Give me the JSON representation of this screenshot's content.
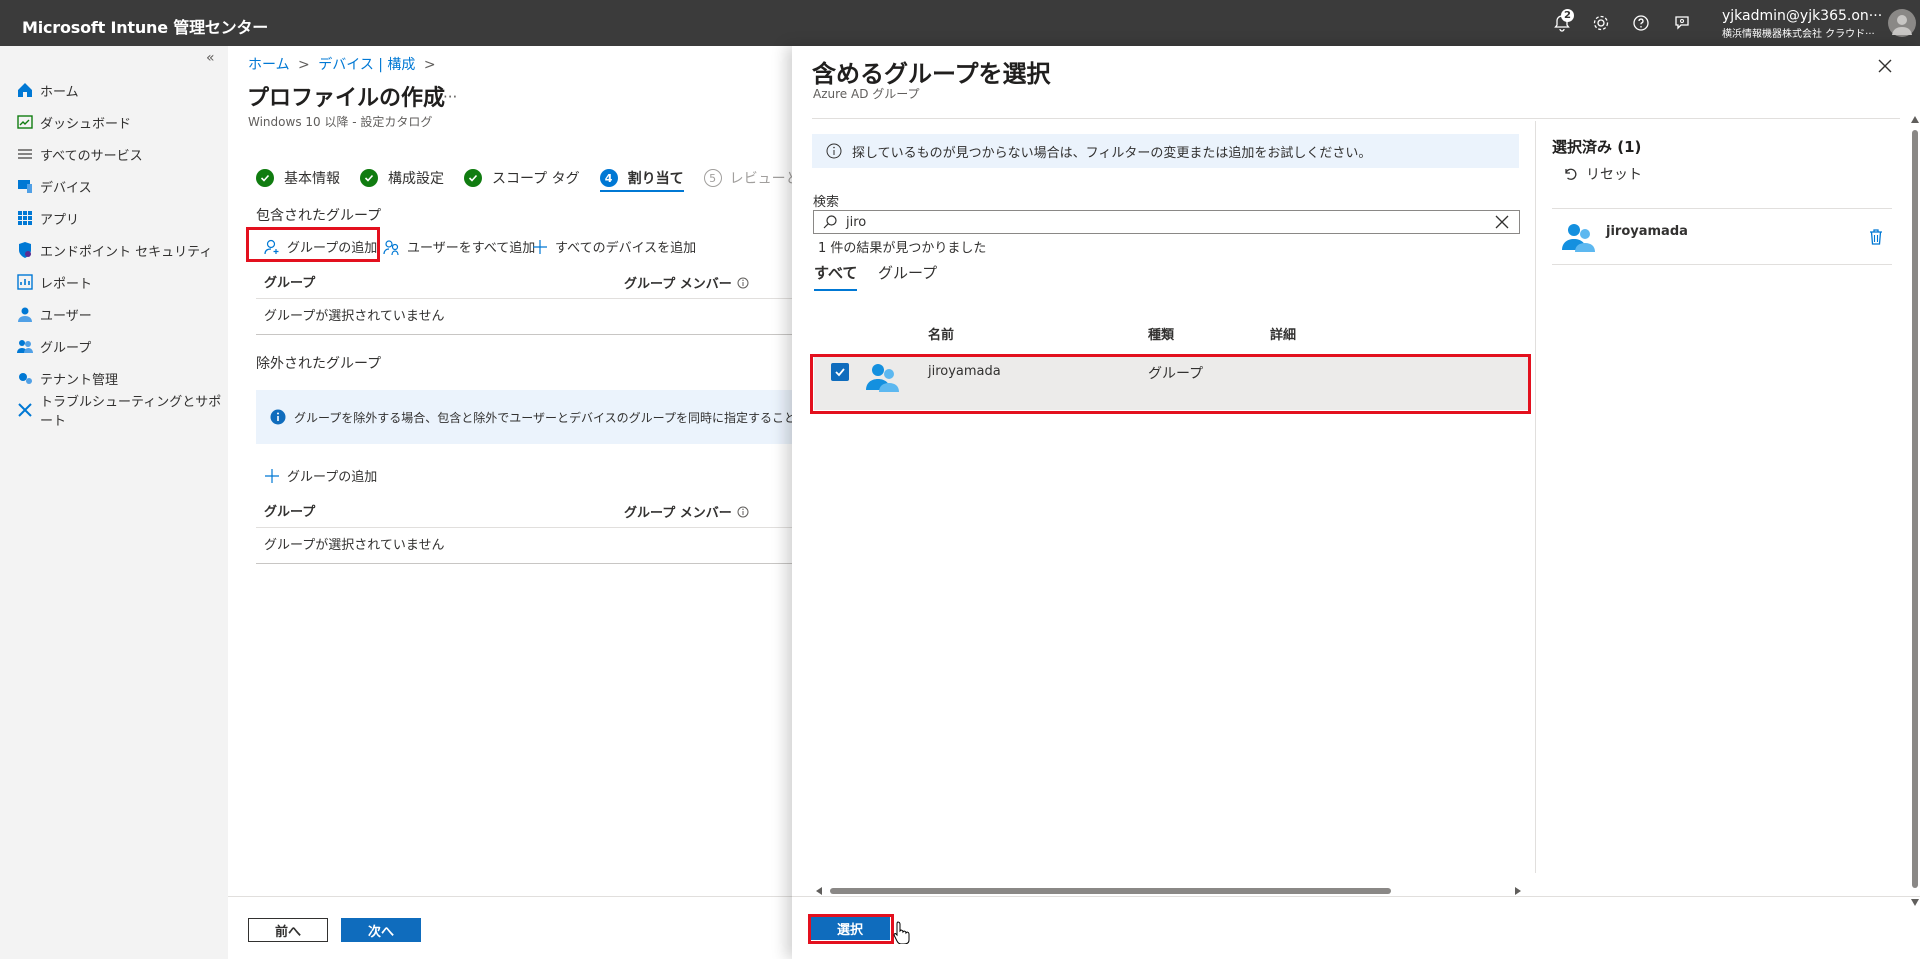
{
  "topbar": {
    "title": "Microsoft Intune 管理センター",
    "notification_count": "2",
    "user_email": "yjkadmin@yjk365.on···",
    "user_org": "横浜情報機器株式会社 クラウド···"
  },
  "sidebar": {
    "collapse": "«",
    "items": [
      {
        "label": "ホーム",
        "icon": "home-icon"
      },
      {
        "label": "ダッシュボード",
        "icon": "dashboard-icon"
      },
      {
        "label": "すべてのサービス",
        "icon": "list-icon"
      },
      {
        "label": "デバイス",
        "icon": "device-icon"
      },
      {
        "label": "アプリ",
        "icon": "apps-icon"
      },
      {
        "label": "エンドポイント セキュリティ",
        "icon": "shield-icon"
      },
      {
        "label": "レポート",
        "icon": "report-icon"
      },
      {
        "label": "ユーザー",
        "icon": "user-icon"
      },
      {
        "label": "グループ",
        "icon": "group-icon"
      },
      {
        "label": "テナント管理",
        "icon": "tenant-icon"
      },
      {
        "label": "トラブルシューティングとサポート",
        "icon": "tools-icon"
      }
    ]
  },
  "main": {
    "breadcrumb": [
      "ホーム",
      "デバイス | 構成"
    ],
    "breadcrumb_sep": ">",
    "title": "プロファイルの作成",
    "more": "···",
    "subtitle": "Windows 10 以降 - 設定カタログ",
    "steps": [
      {
        "label": "基本情報",
        "state": "done"
      },
      {
        "label": "構成設定",
        "state": "done"
      },
      {
        "label": "スコープ タグ",
        "state": "done"
      },
      {
        "label": "割り当て",
        "state": "active",
        "num": "4"
      },
      {
        "label": "レビューと作成",
        "state": "pending",
        "num": "5"
      }
    ],
    "included_title": "包含されたグループ",
    "actions": {
      "add_group": "グループの追加",
      "add_all_users": "ユーザーをすべて追加",
      "add_all_devices": "すべてのデバイスを追加"
    },
    "table_headers": {
      "group": "グループ",
      "members": "グループ メンバー"
    },
    "no_group": "グループが選択されていません",
    "excluded_title": "除外されたグループ",
    "exclude_info": "グループを除外する場合、包含と除外でユーザーとデバイスのグループを同時に指定することはできません。",
    "excluded_add_group": "グループの追加",
    "prev_button": "前へ",
    "next_button": "次へ"
  },
  "panel": {
    "title": "含めるグループを選択",
    "subtitle": "Azure AD グループ",
    "info": "探しているものが見つからない場合は、フィルターの変更または追加をお試しください。",
    "search_label": "検索",
    "search_value": "jiro",
    "result_count": "1 件の結果が見つかりました",
    "tabs": [
      "すべて",
      "グループ"
    ],
    "columns": {
      "name": "名前",
      "type": "種類",
      "detail": "詳細"
    },
    "rows": [
      {
        "name": "jiroyamada",
        "type": "グループ",
        "checked": true
      }
    ],
    "selected_title": "選択済み (1)",
    "reset": "リセット",
    "selected_items": [
      "jiroyamada"
    ],
    "select_button": "選択"
  },
  "colors": {
    "accent": "#0078d4",
    "highlight": "#e3101e",
    "success": "#107c10",
    "topbar": "#3b3b3b"
  }
}
